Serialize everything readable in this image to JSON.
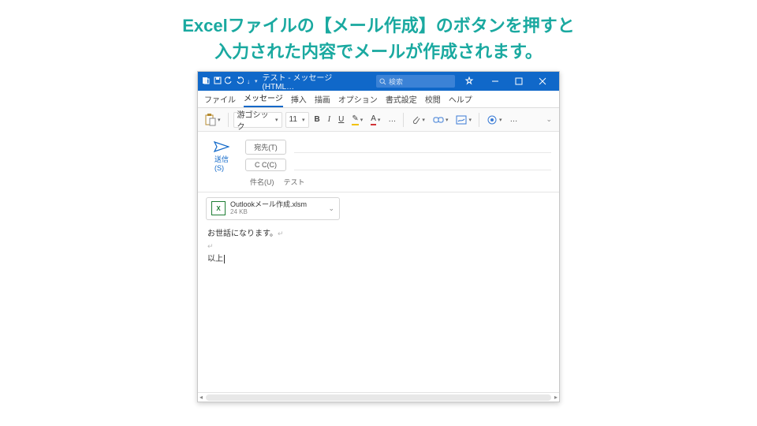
{
  "caption": {
    "line1": "Excelファイルの【メール作成】のボタンを押すと",
    "line2": "入力された内容でメールが作成されます。"
  },
  "titlebar": {
    "title": "テスト - メッセージ (HTML…",
    "search_placeholder": "検索"
  },
  "tabs": [
    "ファイル",
    "メッセージ",
    "挿入",
    "描画",
    "オプション",
    "書式設定",
    "校閲",
    "ヘルプ"
  ],
  "active_tab_index": 1,
  "ribbon": {
    "font_name": "游ゴシック",
    "font_size": "11",
    "bold": "B",
    "italic": "I",
    "underline": "U",
    "pen": "✎",
    "font_color": "A",
    "ellipsis": "…"
  },
  "compose": {
    "send": "送信",
    "send_shortcut": "(S)",
    "to_label": "宛先(T)",
    "cc_label": "C C(C)",
    "subject_label": "件名(U)",
    "subject_value": "テスト"
  },
  "attachment": {
    "filename": "Outlookメール作成.xlsm",
    "size": "24 KB"
  },
  "body": {
    "p1": "お世話になります。",
    "p2": "",
    "p3": "以上"
  }
}
